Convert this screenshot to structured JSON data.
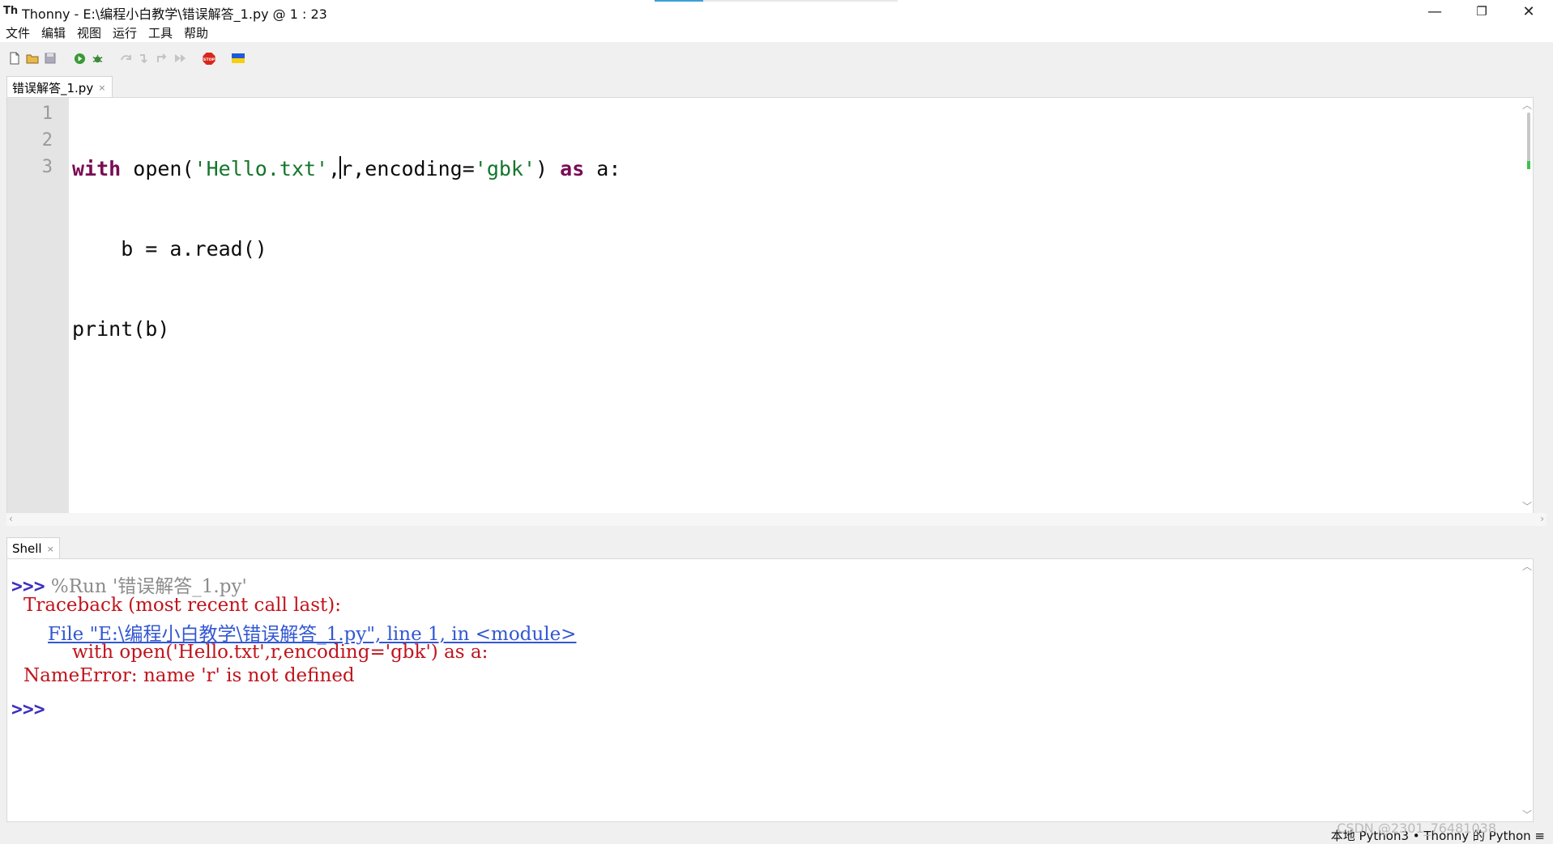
{
  "window": {
    "title": "Thonny  -  E:\\编程小白教学\\错误解答_1.py  @  1 : 23",
    "app_icon_text": "Th",
    "controls": {
      "minimize": "—",
      "maximize": "❐",
      "close": "✕"
    }
  },
  "menu": [
    "文件",
    "编辑",
    "视图",
    "运行",
    "工具",
    "帮助"
  ],
  "toolbar": {
    "buttons": [
      "new-file",
      "open-file",
      "save-file",
      "run",
      "debug",
      "step-over",
      "step-into",
      "step-out",
      "resume",
      "stop",
      "support-ukraine-flag"
    ],
    "stop_label": "STOP"
  },
  "editor": {
    "tab_label": "错误解答_1.py",
    "tab_close": "×",
    "line_numbers": [
      "1",
      "2",
      "3"
    ],
    "lines": [
      {
        "kw1": "with",
        "sp1": " ",
        "ident1": "open(",
        "str1": "'Hello.txt'",
        "ident2": ",",
        "ident3": "r,encoding=",
        "str2": "'gbk'",
        "ident4": ") ",
        "kw2": "as",
        "ident5": " a:"
      },
      {
        "text": "    b = a.read()"
      },
      {
        "text": "print(b)"
      }
    ]
  },
  "shell": {
    "tab_label": "Shell",
    "tab_close": "×",
    "prompt": ">>>",
    "run_command": " %Run '错误解答_1.py'",
    "traceback_header": "Traceback (most recent call last):",
    "traceback_file": "File \"E:\\编程小白教学\\错误解答_1.py\", line 1, in <module>",
    "traceback_code": "with open('Hello.txt',r,encoding='gbk') as a:",
    "error": "NameError: name 'r' is not defined",
    "final_prompt": ">>>"
  },
  "status": {
    "text": "本地 Python3 • Thonny 的 Python ≡",
    "watermark": "CSDN @2301_76481038"
  }
}
